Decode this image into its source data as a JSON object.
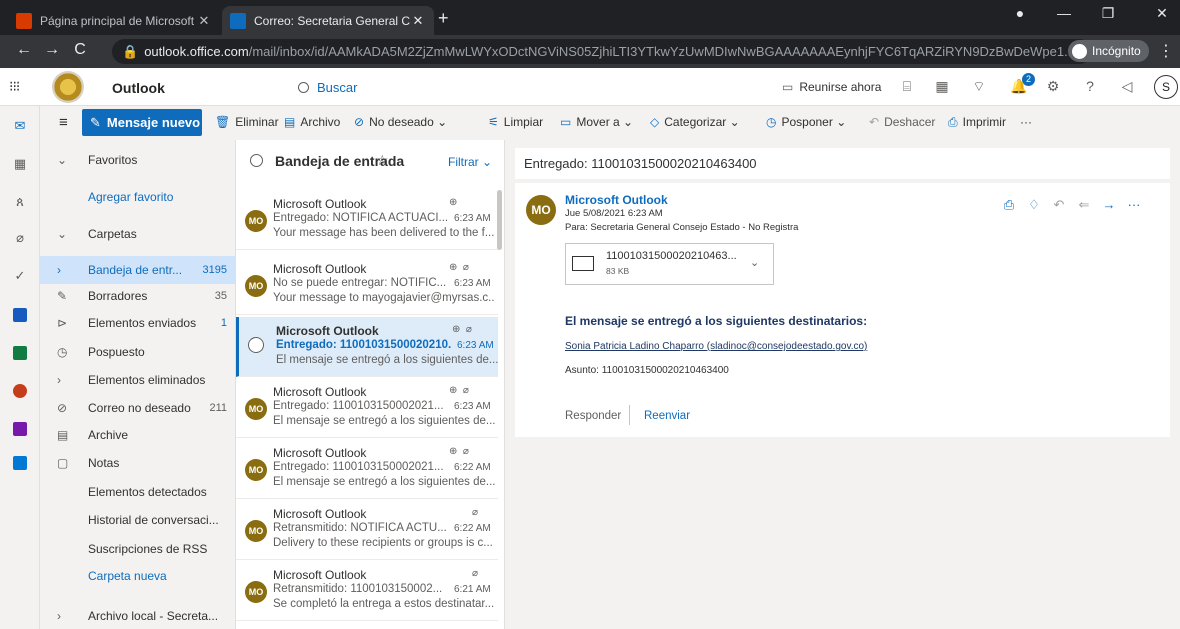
{
  "browser": {
    "tabs": [
      {
        "title": "Página principal de Microsoft Of",
        "active": false
      },
      {
        "title": "Correo: Secretaria General Conse",
        "active": true
      }
    ],
    "url_host": "outlook.office.com",
    "url_path": "/mail/inbox/id/AAMkADA5M2ZjZmMwLWYxODctNGViNS05ZjhiLTI3YTkwYzUwMDIwNwBGAAAAAAAEynhjFYC6TqARZiRYN9DzBwDeWpe1...",
    "incognito_label": "Incógnito"
  },
  "header": {
    "app_name": "Outlook",
    "search_placeholder": "Buscar",
    "meet_now": "Reunirse ahora",
    "notifications_count": "2",
    "avatar_initial": "S"
  },
  "toolbar": {
    "new_message": "Mensaje nuevo",
    "delete": "Eliminar",
    "archive": "Archivo",
    "junk": "No deseado",
    "sweep": "Limpiar",
    "move_to": "Mover a",
    "categorize": "Categorizar",
    "snooze": "Posponer",
    "undo": "Deshacer",
    "print": "Imprimir",
    "more": "···"
  },
  "folders": {
    "favorites": "Favoritos",
    "add_favorite": "Agregar favorito",
    "folders_label": "Carpetas",
    "items": [
      {
        "label": "Bandeja de entr...",
        "count": "3195"
      },
      {
        "label": "Borradores",
        "count": "35"
      },
      {
        "label": "Elementos enviados",
        "count": "1"
      },
      {
        "label": "Pospuesto",
        "count": ""
      },
      {
        "label": "Elementos eliminados",
        "count": ""
      },
      {
        "label": "Correo no deseado",
        "count": "211"
      },
      {
        "label": "Archive",
        "count": ""
      },
      {
        "label": "Notas",
        "count": ""
      },
      {
        "label": "Elementos detectados",
        "count": ""
      },
      {
        "label": "Historial de conversaci...",
        "count": ""
      },
      {
        "label": "Suscripciones de RSS",
        "count": ""
      }
    ],
    "new_folder": "Carpeta nueva",
    "local_archive": "Archivo local - Secreta..."
  },
  "message_list": {
    "title": "Bandeja de entrada",
    "filter": "Filtrar",
    "messages": [
      {
        "avatar": "MO",
        "from": "Microsoft Outlook",
        "subject": "Entregado: NOTIFICA ACTUACI...",
        "time": "6:23 AM",
        "preview": "Your message has been delivered to the f..."
      },
      {
        "avatar": "MO",
        "from": "Microsoft Outlook",
        "subject": "No se puede entregar: NOTIFIC...",
        "time": "6:23 AM",
        "preview": "Your message to mayogajavier@myrsas.c..."
      },
      {
        "avatar": "",
        "from": "Microsoft Outlook",
        "subject": "Entregado: 11001031500020210...",
        "time": "6:23 AM",
        "preview": "El mensaje se entregó a los siguientes de..."
      },
      {
        "avatar": "MO",
        "from": "Microsoft Outlook",
        "subject": "Entregado: 1100103150002021...",
        "time": "6:23 AM",
        "preview": "El mensaje se entregó a los siguientes de..."
      },
      {
        "avatar": "MO",
        "from": "Microsoft Outlook",
        "subject": "Entregado: 1100103150002021...",
        "time": "6:22 AM",
        "preview": "El mensaje se entregó a los siguientes de..."
      },
      {
        "avatar": "MO",
        "from": "Microsoft Outlook",
        "subject": "Retransmitido: NOTIFICA ACTU...",
        "time": "6:22 AM",
        "preview": "Delivery to these recipients or groups is c..."
      },
      {
        "avatar": "MO",
        "from": "Microsoft Outlook",
        "subject": "Retransmitido: 1100103150002...",
        "time": "6:21 AM",
        "preview": "Se completó la entrega a estos destinatar..."
      }
    ]
  },
  "reading": {
    "title": "Entregado: 11001031500020210463400",
    "avatar": "MO",
    "from": "Microsoft Outlook",
    "date": "Jue 5/08/2021 6:23 AM",
    "to": "Para: Secretaria General Consejo Estado - No Registra",
    "attachment_name": "11001031500020210463...",
    "attachment_size": "83 KB",
    "delivered_heading": "El mensaje se entregó a los siguientes destinatarios:",
    "recipient": "Sonia Patricia Ladino Chaparro (sladinoc@consejodeestado.gov.co)",
    "subject_line": "Asunto: 11001031500020210463400",
    "reply": "Responder",
    "forward": "Reenviar"
  }
}
